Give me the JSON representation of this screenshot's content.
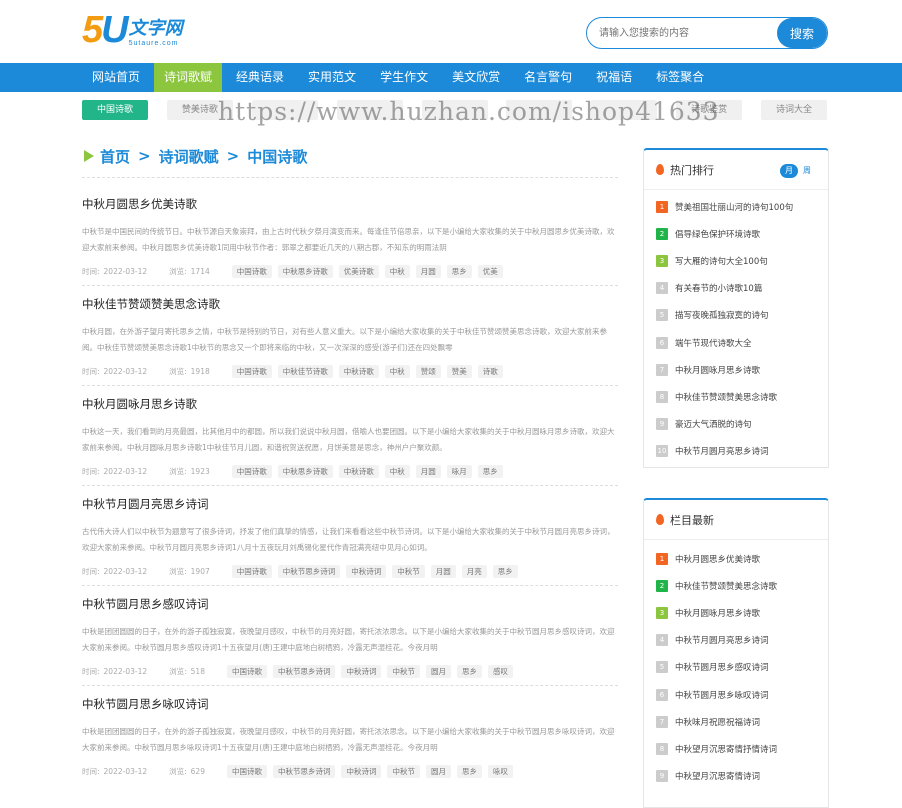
{
  "logo": {
    "num_a": "5",
    "num_b": "U",
    "cn": "文字网",
    "en": "5utaure.com"
  },
  "search": {
    "placeholder": "请输入您搜索的内容",
    "button": "搜索"
  },
  "nav": [
    "网站首页",
    "诗词歌赋",
    "经典语录",
    "实用范文",
    "学生作文",
    "美文欣赏",
    "名言警句",
    "祝福语",
    "标签聚合"
  ],
  "nav_active": 1,
  "subnav": [
    "中国诗歌",
    "赞美诗歌",
    "",
    "",
    "",
    "",
    "",
    "诗歌鉴赏",
    "诗词大全"
  ],
  "watermark": "https://www.huzhan.com/ishop41633",
  "breadcrumb": {
    "home": "首页",
    "sep": ">",
    "cat": "诗词歌赋",
    "sub": "中国诗歌"
  },
  "meta_labels": {
    "time": "时间:",
    "views": "浏览:"
  },
  "articles": [
    {
      "title": "中秋月圆思乡优美诗歌",
      "summary": "中秋节是中国民间的传统节日。中秋节源自天象崇拜，由上古时代秋夕祭月演变而来。每逢佳节倍思亲，以下是小编给大家收集的关于中秋月圆思乡优美诗歌，欢迎大家前来参阅。中秋月圆思乡优美诗歌1同用中秋节作者：郭翠之都要近几天的八期古郡，不知东的明雨法阴",
      "date": "2022-03-12",
      "views": "1714",
      "tags": [
        "中国诗歌",
        "中秋思乡诗歌",
        "优美诗歌",
        "中秋",
        "月圆",
        "思乡",
        "优美"
      ]
    },
    {
      "title": "中秋佳节赞颂赞美思念诗歌",
      "summary": "中秋月圆，在外游子望月寄托思乡之情，中秋节是特别的节日，对有些人意义重大。以下是小编给大家收集的关于中秋佳节赞颂赞美思念诗歌，欢迎大家前来参阅。中秋佳节赞颂赞美思念诗歌1中秋节的思念又一个即将来临的中秋，又一次深深的感受(游子们)还在四处飘零",
      "date": "2022-03-12",
      "views": "1918",
      "tags": [
        "中国诗歌",
        "中秋佳节诗歌",
        "中秋诗歌",
        "中秋",
        "赞颂",
        "赞美",
        "诗歌"
      ]
    },
    {
      "title": "中秋月圆咏月思乡诗歌",
      "summary": "中秋这一天，我们看到的月亮最圆，比其他月中的都圆，所以我们说说中秋月圆，借喻人也要团圆。以下是小编给大家收集的关于中秋月圆咏月思乡诗歌，欢迎大家前来参阅。中秋月圆咏月思乡诗歌1中秋佳节月儿圆，和谐祝贺送祝愿，月饼美意是思念，神州户户聚欢颜。",
      "date": "2022-03-12",
      "views": "1923",
      "tags": [
        "中国诗歌",
        "中秋思乡诗歌",
        "中秋诗歌",
        "中秋",
        "月圆",
        "咏月",
        "思乡"
      ]
    },
    {
      "title": "中秋节月圆月亮思乡诗词",
      "summary": "古代伟大诗人们以中秋节为题意写了很多诗词，抒发了他们真挚的情感，让我们来看看这些中秋节诗词。以下是小编给大家收集的关于中秋节月圆月亮思乡诗词，欢迎大家前来参阅。中秋节月圆月亮思乡诗词1八月十五夜玩月刘禹锡化星代作青冠满亮纽中见月心如词。",
      "date": "2022-03-12",
      "views": "1907",
      "tags": [
        "中国诗歌",
        "中秋节思乡诗词",
        "中秋诗词",
        "中秋节",
        "月圆",
        "月亮",
        "思乡"
      ]
    },
    {
      "title": "中秋节圆月思乡感叹诗词",
      "summary": "中秋是团团圆圆的日子，在外的游子孤独寂寞，夜晚望月感叹，中秋节的月亮好圆，寄托浓浓思念。以下是小编给大家收集的关于中秋节圆月思乡感叹诗词，欢迎大家前来参阅。中秋节圆月思乡感叹诗词1十五夜望月(唐)王建中庭地白树栖鸦，冷露无声湿桂花。今夜月明",
      "date": "2022-03-12",
      "views": "518",
      "tags": [
        "中国诗歌",
        "中秋节思乡诗词",
        "中秋诗词",
        "中秋节",
        "圆月",
        "思乡",
        "感叹"
      ]
    },
    {
      "title": "中秋节圆月思乡咏叹诗词",
      "summary": "中秋是团团圆圆的日子，在外的游子孤独寂寞，夜晚望月感叹，中秋节的月亮好圆，寄托浓浓思念。以下是小编给大家收集的关于中秋节圆月思乡咏叹诗词，欢迎大家前来参阅。中秋节圆月思乡咏叹诗词1十五夜望月(唐)王建中庭地白树栖鸦，冷露无声湿桂花。今夜月明",
      "date": "2022-03-12",
      "views": "629",
      "tags": [
        "中国诗歌",
        "中秋节思乡诗词",
        "中秋诗词",
        "中秋节",
        "圆月",
        "思乡",
        "咏叹"
      ]
    }
  ],
  "hot": {
    "title": "热门排行",
    "tab_month": "月",
    "tab_week": "周",
    "items": [
      "赞美祖国壮丽山河的诗句100句",
      "倡导绿色保护环境诗歌",
      "写大雁的诗句大全100句",
      "有关春节的小诗歌10篇",
      "描写夜晚孤独寂寞的诗句",
      "端午节现代诗歌大全",
      "中秋月圆咏月思乡诗歌",
      "中秋佳节赞颂赞美思念诗歌",
      "豪迈大气洒脱的诗句",
      "中秋节月圆月亮思乡诗词"
    ]
  },
  "latest": {
    "title": "栏目最新",
    "items": [
      "中秋月圆思乡优美诗歌",
      "中秋佳节赞颂赞美思念诗歌",
      "中秋月圆咏月思乡诗歌",
      "中秋节月圆月亮思乡诗词",
      "中秋节圆月思乡感叹诗词",
      "中秋节圆月思乡咏叹诗词",
      "中秋味月祝愿祝福诗词",
      "中秋望月沉思寄情抒情诗词",
      "中秋望月沉思寄情诗词"
    ]
  }
}
